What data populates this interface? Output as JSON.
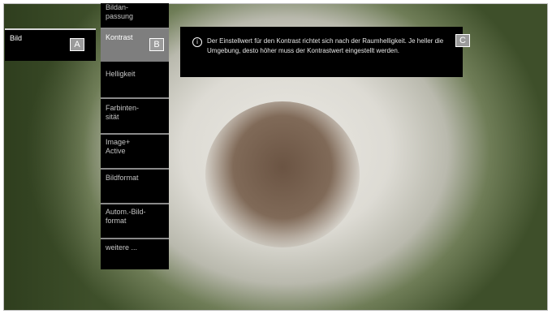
{
  "panel_a": {
    "label": "Bild"
  },
  "badges": {
    "a": "A",
    "b": "B",
    "c": "C"
  },
  "menu": {
    "items": [
      {
        "label": "Bildan-\npassung"
      },
      {
        "label": "Kontrast"
      },
      {
        "label": "Helligkeit"
      },
      {
        "label": "Farbinten-\nsität"
      },
      {
        "label": "Image+\nActive"
      },
      {
        "label": "Bildformat"
      },
      {
        "label": "Autom.-Bild-\nformat"
      },
      {
        "label": "weitere ..."
      }
    ]
  },
  "info": {
    "icon": "info-icon",
    "text": "Der Einstellwert für den Kontrast richtet sich nach der Raumhelligkeit. Je heller die Umgebung, desto höher muss der Kontrastwert eingestellt werden."
  }
}
